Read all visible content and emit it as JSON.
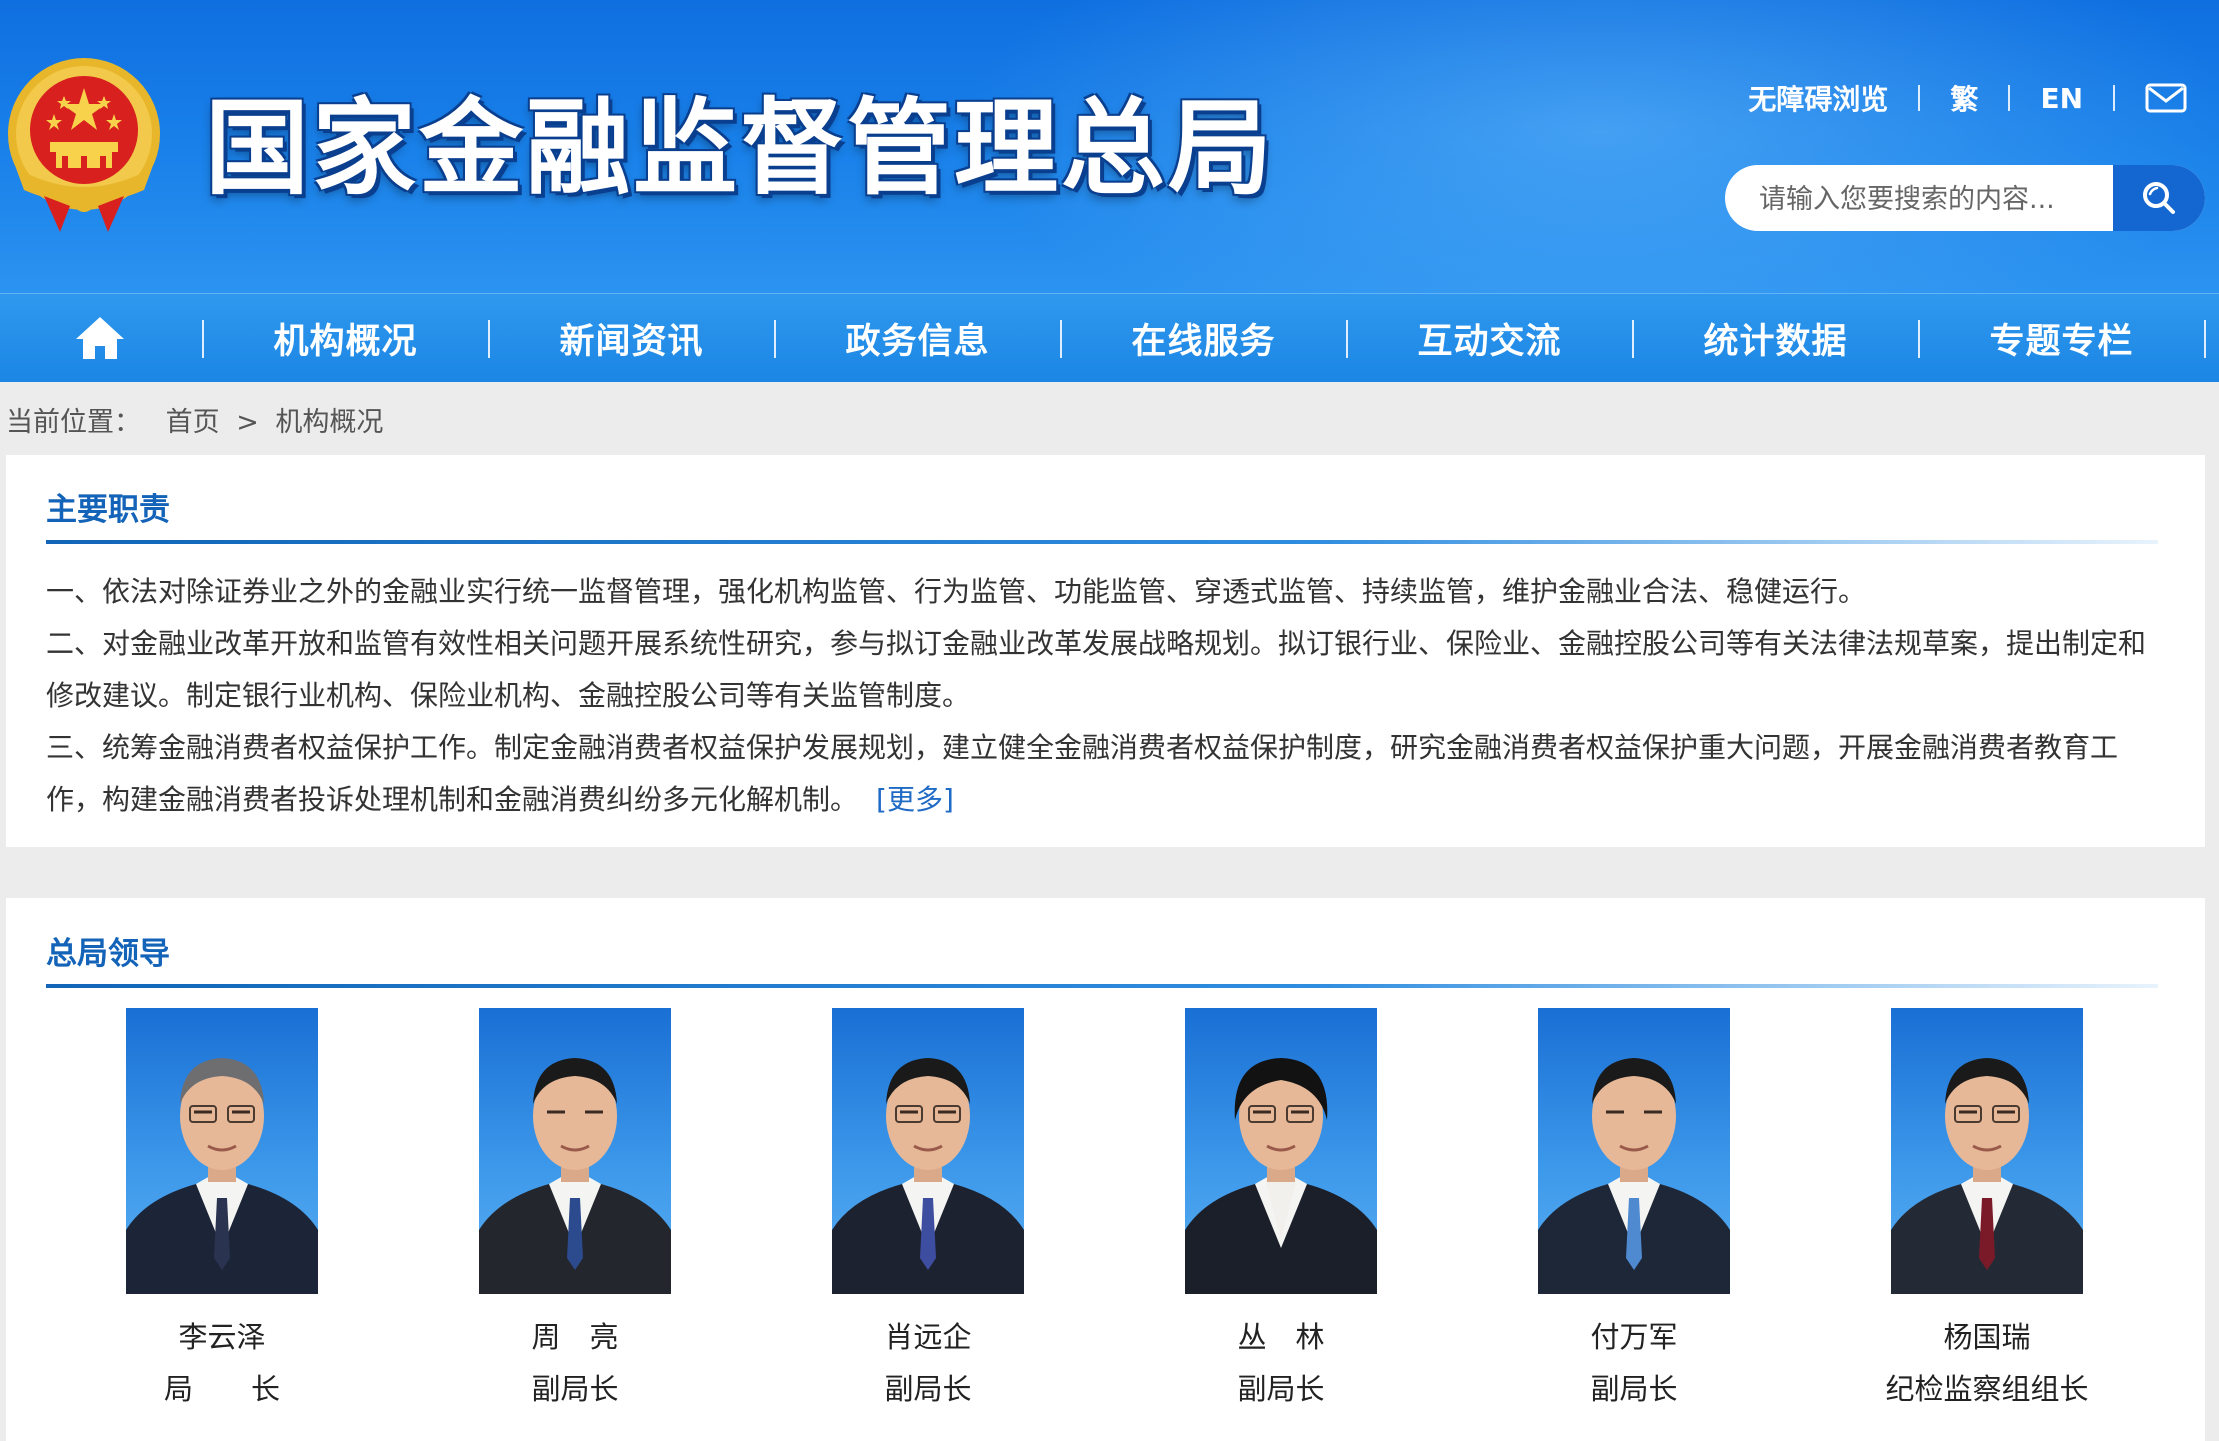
{
  "header": {
    "site_title": "国家金融监督管理总局",
    "links": [
      "无障碍浏览",
      "繁",
      "EN"
    ],
    "search_placeholder": "请输入您要搜索的内容..."
  },
  "nav": {
    "items": [
      "机构概况",
      "新闻资讯",
      "政务信息",
      "在线服务",
      "互动交流",
      "统计数据",
      "专题专栏"
    ]
  },
  "breadcrumb": {
    "prefix": "当前位置：",
    "home": "首页",
    "separator": ">",
    "current": "机构概况"
  },
  "duties": {
    "title": "主要职责",
    "items": [
      "一、依法对除证券业之外的金融业实行统一监督管理，强化机构监管、行为监管、功能监管、穿透式监管、持续监管，维护金融业合法、稳健运行。",
      "二、对金融业改革开放和监管有效性相关问题开展系统性研究，参与拟订金融业改革发展战略规划。拟订银行业、保险业、金融控股公司等有关法律法规草案，提出制定和修改建议。制定银行业机构、保险业机构、金融控股公司等有关监管制度。",
      "三、统筹金融消费者权益保护工作。制定金融消费者权益保护发展规划，建立健全金融消费者权益保护制度，研究金融消费者权益保护重大问题，开展金融消费者教育工作，构建金融消费者投诉处理机制和金融消费纠纷多元化解机制。"
    ],
    "more_label": "[更多]"
  },
  "leaders": {
    "title": "总局领导",
    "people": [
      {
        "name": "李云泽",
        "title": "局　　长",
        "suit": "#1c2438",
        "tie": "#2a3350"
      },
      {
        "name": "周　亮",
        "title": "副局长",
        "suit": "#23262d",
        "tie": "#2c4a8e"
      },
      {
        "name": "肖远企",
        "title": "副局长",
        "suit": "#1d2230",
        "tie": "#3d4ea0"
      },
      {
        "name": "丛　林",
        "title": "副局长",
        "suit": "#1b1f2a",
        "tie": "#f2f0ec"
      },
      {
        "name": "付万军",
        "title": "副局长",
        "suit": "#1e2738",
        "tie": "#4f8ad0"
      },
      {
        "name": "杨国瑞",
        "title": "纪检监察组组长",
        "suit": "#242a35",
        "tie": "#7a1a28"
      }
    ]
  },
  "colors": {
    "header_blue": "#1a82ea",
    "nav_blue": "#2b93ec",
    "section_title": "#1363b8",
    "link": "#1f6ac5"
  }
}
